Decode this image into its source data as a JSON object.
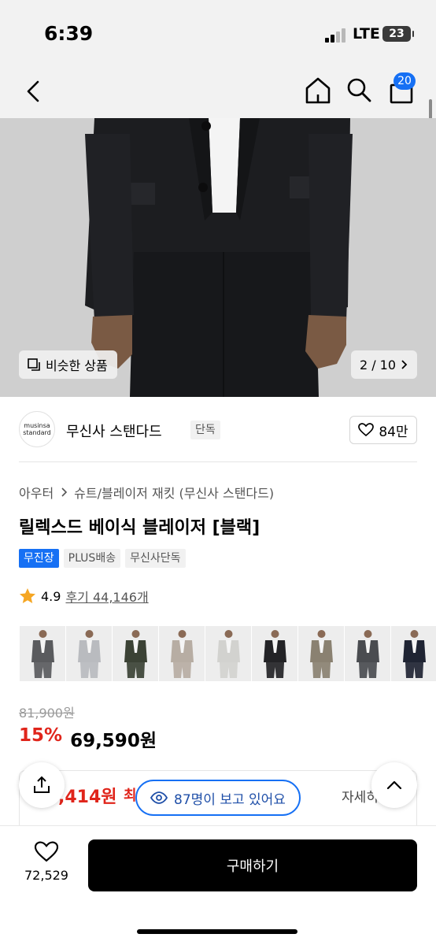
{
  "status_bar": {
    "time": "6:39",
    "network": "LTE",
    "battery": "23"
  },
  "nav": {
    "cart_count": "20",
    "icons": [
      "chevron-left-icon",
      "home-icon",
      "search-icon",
      "cart-icon"
    ]
  },
  "hero": {
    "similar_label": "비슷한 상품",
    "pager": "2 / 10"
  },
  "brand": {
    "logo_line1": "musinsa",
    "logo_line2": "standard",
    "name": "무신사 스탠다드",
    "tag": "단독",
    "likes": "84만"
  },
  "breadcrumb": {
    "category": "아우터",
    "subcategory": "슈트/블레이저 재킷 (무신사 스탠다드)"
  },
  "product": {
    "title": "릴렉스드 베이식 블레이저 [블랙]",
    "tags": [
      "무진장",
      "PLUS배송",
      "무신사단독"
    ],
    "rating": "4.9",
    "review_label": "후기 44,146개"
  },
  "colors": {
    "swatches": [
      "#5a5b5e",
      "#b9bbbf",
      "#3b4235",
      "#b7ada3",
      "#d2d2cf",
      "#232326",
      "#8a8171",
      "#4a4c50",
      "#1f2433"
    ]
  },
  "price": {
    "original": "81,900원",
    "discount": "15%",
    "sale": "69,590원"
  },
  "benefit": {
    "price": ",414원",
    "suffix": "최",
    "detail": "자세히"
  },
  "viewers": {
    "label": "87명이 보고 있어요"
  },
  "bottom": {
    "like_count": "72,529",
    "buy_label": "구매하기"
  }
}
